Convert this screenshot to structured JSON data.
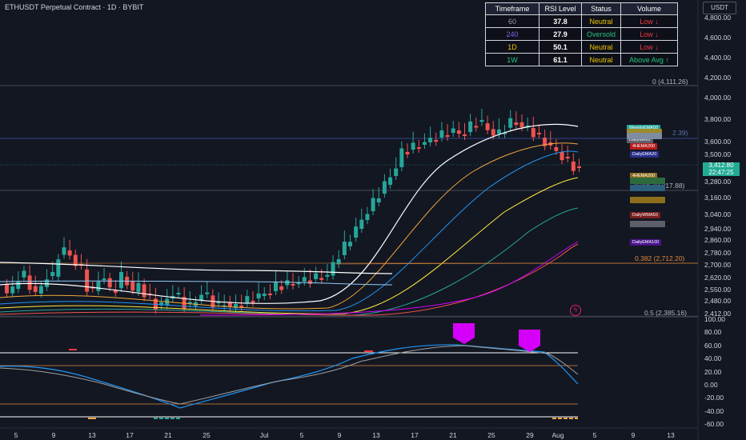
{
  "symbol_title": "ETHUSDT Perpetual Contract · 1D · BYBIT",
  "currency_button": "USDT",
  "rsi_table": {
    "headers": [
      "Timeframe",
      "RSI Level",
      "Status",
      "Volume"
    ],
    "rows": [
      {
        "tf": "60",
        "rsi": "37.8",
        "status": "Neutral",
        "volume": "Low ↓",
        "tf_color": "#9598a1",
        "status_color": "#f0c400",
        "vol_color": "#f23645"
      },
      {
        "tf": "240",
        "rsi": "27.9",
        "status": "Oversold",
        "volume": "Low ↓",
        "tf_color": "#7b68ee",
        "status_color": "#26c281",
        "vol_color": "#f23645"
      },
      {
        "tf": "1D",
        "rsi": "50.1",
        "status": "Neutral",
        "volume": "Low ↓",
        "tf_color": "#f0c400",
        "status_color": "#f0c400",
        "vol_color": "#f23645"
      },
      {
        "tf": "1W",
        "rsi": "61.1",
        "status": "Neutral",
        "volume": "Above Avg ↑",
        "tf_color": "#26c281",
        "status_color": "#f0c400",
        "vol_color": "#26c281"
      }
    ]
  },
  "price_axis": [
    "4,800.00",
    "4,600.00",
    "4,400.00",
    "4,200.00",
    "4,000.00",
    "3,800.00",
    "3,600.00",
    "3,500.00",
    "3,400.00",
    "3,280.00",
    "3,160.00",
    "3,040.00",
    "2,940.00",
    "2,860.00",
    "2,780.00",
    "2,700.00",
    "2,620.00",
    "2,550.00",
    "2,480.00",
    "2,412.00"
  ],
  "rsi_axis": [
    "100.00",
    "80.00",
    "60.00",
    "40.00",
    "20.00",
    "0.00",
    "-20.00",
    "-40.00",
    "-60.00"
  ],
  "time_axis": [
    "5",
    "9",
    "13",
    "17",
    "21",
    "25",
    "Jul",
    "5",
    "9",
    "13",
    "17",
    "21",
    "25",
    "29",
    "Aug",
    "5",
    "9",
    "13"
  ],
  "last_price": "3,412.80",
  "countdown": "22:47:25",
  "fib_levels": [
    {
      "label": "0 (4,111.26)",
      "color": "#b2b5be"
    },
    {
      "label": "0.225 (3,217.88)",
      "color": "#b2b5be"
    },
    {
      "label": "0.382 (2,712.20)",
      "color": "#e3893a"
    },
    {
      "label": "0.5 (2,385.16)",
      "color": "#b2b5be"
    }
  ],
  "fib_partial_label": "2.39)",
  "ma_tags": [
    {
      "label": "WeeklyEMA50",
      "color": "#26a69a"
    },
    {
      "label": "DailyMA20",
      "color": "#5d606b"
    },
    {
      "label": "4HEMA200",
      "color": "#b71c1c"
    },
    {
      "label": "DailyEMA20",
      "color": "#2a2e8c"
    },
    {
      "label": "4HEMA200",
      "color": "#8d6e1b"
    },
    {
      "label": "DailyWMA50",
      "color": "#7a1f1f"
    },
    {
      "label": "DailyEMA100",
      "color": "#4a148c"
    }
  ],
  "colors": {
    "bull": "#26a69a",
    "bear": "#ef5350",
    "background": "#131722",
    "rsi_line": "#2196f3",
    "stoch_line": "#f23645",
    "marker": "#d500f9"
  }
}
